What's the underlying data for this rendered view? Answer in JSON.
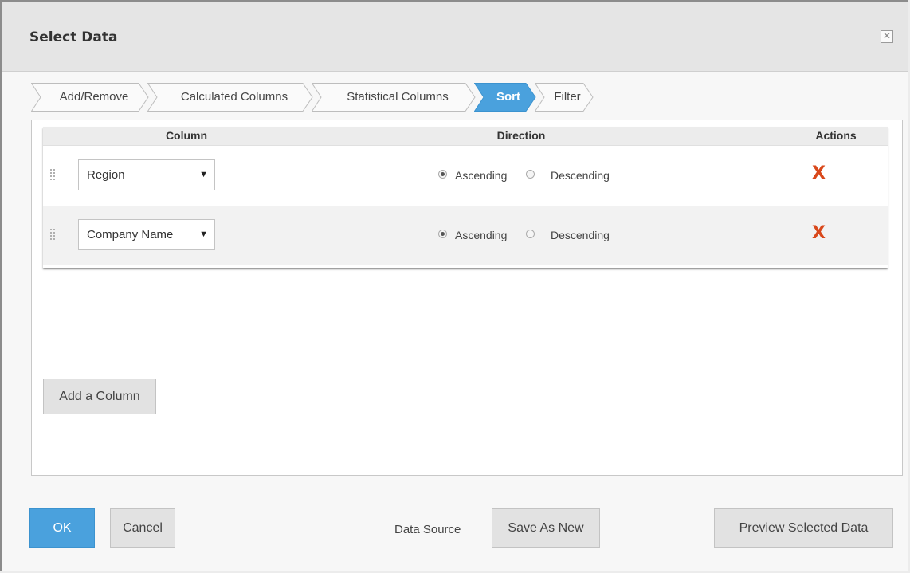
{
  "dialog": {
    "title": "Select Data",
    "close_icon": "close-icon"
  },
  "tabs": [
    {
      "label": "Add/Remove",
      "active": false
    },
    {
      "label": "Calculated Columns",
      "active": false
    },
    {
      "label": "Statistical Columns",
      "active": false
    },
    {
      "label": "Sort",
      "active": true
    },
    {
      "label": "Filter",
      "active": false
    }
  ],
  "sort_table": {
    "headers": {
      "column": "Column",
      "direction": "Direction",
      "actions": "Actions"
    },
    "rows": [
      {
        "column": "Region",
        "direction": "Ascending",
        "ascending_label": "Ascending",
        "descending_label": "Descending",
        "remove_glyph": "X"
      },
      {
        "column": "Company Name",
        "direction": "Ascending",
        "ascending_label": "Ascending",
        "descending_label": "Descending",
        "remove_glyph": "X"
      }
    ],
    "select_arrow": "▼"
  },
  "add_column_label": "Add a Column",
  "footer": {
    "ok_label": "OK",
    "cancel_label": "Cancel",
    "data_source_label": "Data Source",
    "save_as_new_label": "Save As New",
    "preview_label": "Preview Selected Data"
  },
  "colors": {
    "active_tab": "#4aa1dd",
    "primary_button": "#4aa1dd",
    "remove_icon": "#d9481b"
  }
}
